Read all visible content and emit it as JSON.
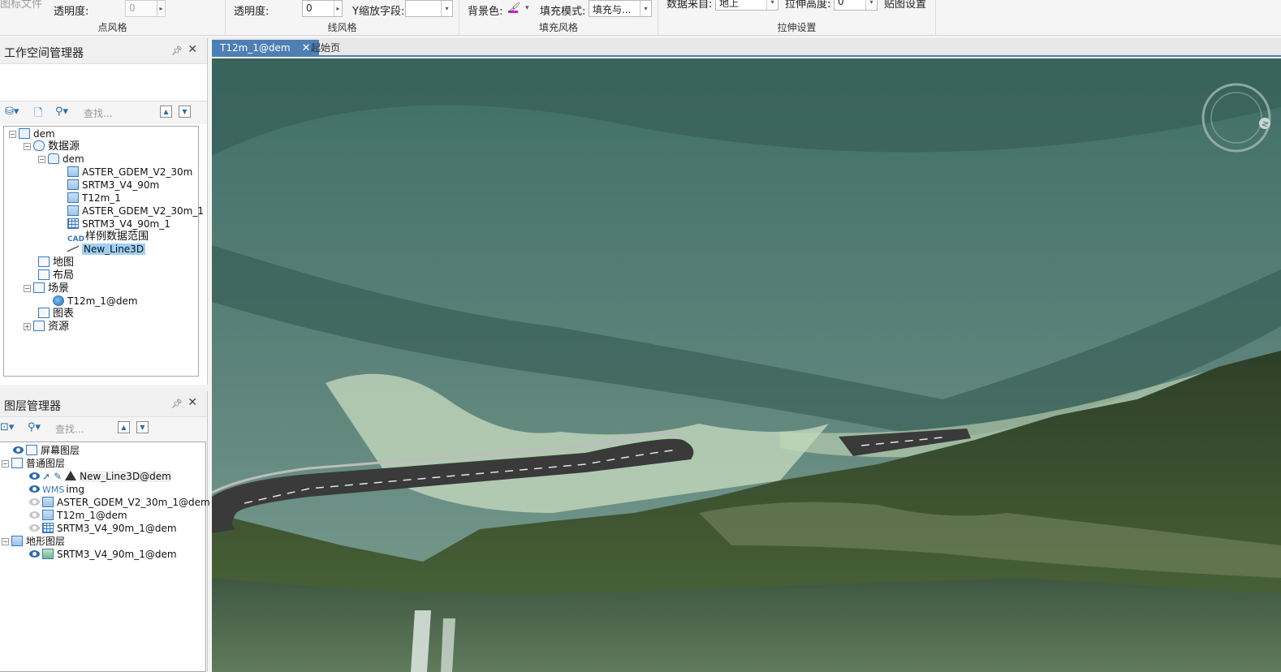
{
  "ribbon": {
    "point_style": {
      "file_label": "图标文件",
      "opacity_label": "透明度:",
      "opacity_value": "0",
      "group_label": "点风格"
    },
    "line_style": {
      "opacity_label": "透明度:",
      "opacity_value": "0",
      "y_scale_label": "Y缩放字段:",
      "y_scale_value": "",
      "group_label": "线风格"
    },
    "fill_style": {
      "bg_color_label": "背景色:",
      "fill_mode_label": "填充模式:",
      "fill_mode_value": "填充与...",
      "group_label": "填充风格"
    },
    "extrude": {
      "source_label": "数据来自:",
      "source_value": "地上",
      "height_label": "拉伸高度:",
      "height_value": "0",
      "map_settings_label": "贴图设置",
      "group_label": "拉伸设置"
    }
  },
  "workspace": {
    "title": "工作空间管理器",
    "search_placeholder": "查找...",
    "tree": {
      "root": "dem",
      "datasources": "数据源",
      "datasource": "dem",
      "datasets": [
        "ASTER_GDEM_V2_30m",
        "SRTM3_V4_90m",
        "T12m_1",
        "ASTER_GDEM_V2_30m_1",
        "SRTM3_V4_90m_1",
        "样例数据范围",
        "New_Line3D"
      ],
      "maps": "地图",
      "layouts": "布局",
      "scenes": "场景",
      "scene_item": "T12m_1@dem",
      "charts": "图表",
      "resources": "资源"
    }
  },
  "layers": {
    "title": "图层管理器",
    "search_placeholder": "查找...",
    "screen_layers": "屏幕图层",
    "normal_layers": "普通图层",
    "normal_items": [
      "New_Line3D@dem",
      "img",
      "ASTER_GDEM_V2_30m_1@dem",
      "T12m_1@dem",
      "SRTM3_V4_90m_1@dem"
    ],
    "terrain_layers": "地形图层",
    "terrain_items": [
      "SRTM3_V4_90m_1@dem"
    ]
  },
  "tabs": [
    "T12m_1@dem",
    "起始页"
  ],
  "colors": {
    "accent": "#4d7fb5",
    "selection": "#9fd0f5",
    "icon_blue": "#3a78c0"
  },
  "icons": [
    "pin-icon",
    "close-icon",
    "eye-icon",
    "search-icon",
    "compass-icon"
  ]
}
